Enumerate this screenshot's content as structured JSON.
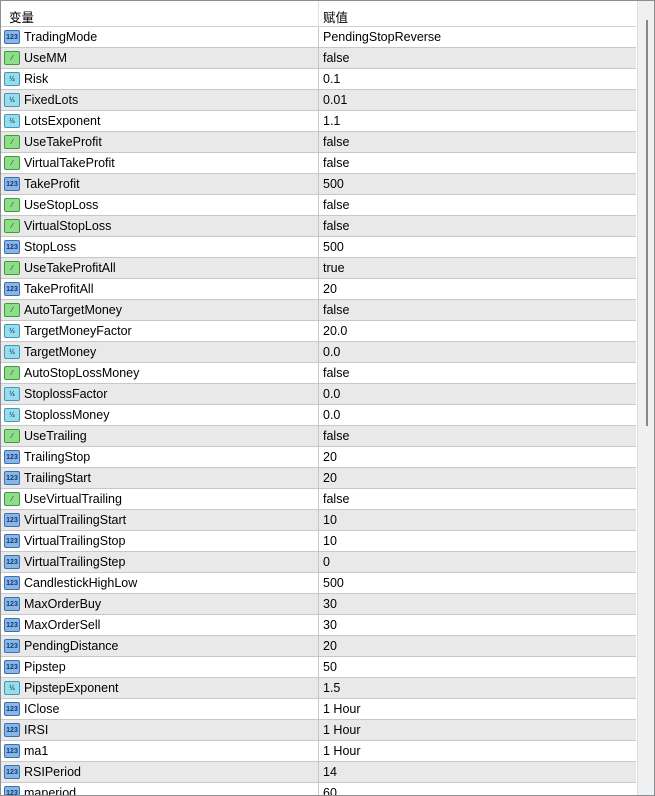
{
  "header": {
    "col_name": "变量",
    "col_value": "赋值"
  },
  "rows": [
    {
      "name": "TradingMode",
      "value": "PendingStopReverse",
      "type": "int"
    },
    {
      "name": "UseMM",
      "value": "false",
      "type": "bool"
    },
    {
      "name": "Risk",
      "value": "0.1",
      "type": "double"
    },
    {
      "name": "FixedLots",
      "value": "0.01",
      "type": "double"
    },
    {
      "name": "LotsExponent",
      "value": "1.1",
      "type": "double"
    },
    {
      "name": "UseTakeProfit",
      "value": "false",
      "type": "bool"
    },
    {
      "name": "VirtualTakeProfit",
      "value": "false",
      "type": "bool"
    },
    {
      "name": "TakeProfit",
      "value": "500",
      "type": "int"
    },
    {
      "name": "UseStopLoss",
      "value": "false",
      "type": "bool"
    },
    {
      "name": "VirtualStopLoss",
      "value": "false",
      "type": "bool"
    },
    {
      "name": "StopLoss",
      "value": "500",
      "type": "int"
    },
    {
      "name": "UseTakeProfitAll",
      "value": "true",
      "type": "bool"
    },
    {
      "name": "TakeProfitAll",
      "value": "20",
      "type": "int"
    },
    {
      "name": "AutoTargetMoney",
      "value": "false",
      "type": "bool"
    },
    {
      "name": "TargetMoneyFactor",
      "value": "20.0",
      "type": "double"
    },
    {
      "name": "TargetMoney",
      "value": "0.0",
      "type": "double"
    },
    {
      "name": "AutoStopLossMoney",
      "value": "false",
      "type": "bool"
    },
    {
      "name": "StoplossFactor",
      "value": "0.0",
      "type": "double"
    },
    {
      "name": "StoplossMoney",
      "value": "0.0",
      "type": "double"
    },
    {
      "name": "UseTrailing",
      "value": "false",
      "type": "bool"
    },
    {
      "name": "TrailingStop",
      "value": "20",
      "type": "int"
    },
    {
      "name": "TrailingStart",
      "value": "20",
      "type": "int"
    },
    {
      "name": "UseVirtualTrailing",
      "value": "false",
      "type": "bool"
    },
    {
      "name": "VirtualTrailingStart",
      "value": "10",
      "type": "int"
    },
    {
      "name": "VirtualTrailingStop",
      "value": "10",
      "type": "int"
    },
    {
      "name": "VirtualTrailingStep",
      "value": "0",
      "type": "int"
    },
    {
      "name": "CandlestickHighLow",
      "value": "500",
      "type": "int"
    },
    {
      "name": "MaxOrderBuy",
      "value": "30",
      "type": "int"
    },
    {
      "name": "MaxOrderSell",
      "value": "30",
      "type": "int"
    },
    {
      "name": "PendingDistance",
      "value": "20",
      "type": "int"
    },
    {
      "name": "Pipstep",
      "value": "50",
      "type": "int"
    },
    {
      "name": "PipstepExponent",
      "value": "1.5",
      "type": "double"
    },
    {
      "name": "IClose",
      "value": "1 Hour",
      "type": "int"
    },
    {
      "name": "IRSI",
      "value": "1 Hour",
      "type": "int"
    },
    {
      "name": "ma1",
      "value": "1 Hour",
      "type": "int"
    },
    {
      "name": "RSIPeriod",
      "value": "14",
      "type": "int"
    },
    {
      "name": "maperiod",
      "value": "60",
      "type": "int"
    }
  ],
  "icons": {
    "int": "123",
    "bool": "⁄",
    "double": "½"
  }
}
